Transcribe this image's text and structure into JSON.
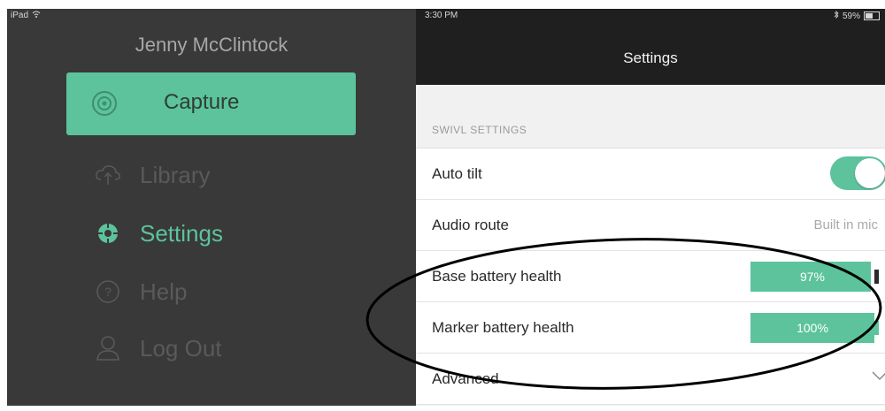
{
  "status_bar": {
    "device": "iPad",
    "time": "3:30 PM",
    "battery": "59%"
  },
  "sidebar": {
    "user_name": "Jenny McClintock",
    "capture_label": "Capture",
    "items": [
      {
        "label": "Library",
        "icon": "cloud-upload-icon"
      },
      {
        "label": "Settings",
        "icon": "gear-icon",
        "active": true
      },
      {
        "label": "Help",
        "icon": "help-icon"
      },
      {
        "label": "Log Out",
        "icon": "user-icon"
      }
    ]
  },
  "settings": {
    "title": "Settings",
    "section_header": "SWIVL SETTINGS",
    "auto_tilt": {
      "label": "Auto tilt",
      "on": true
    },
    "audio_route": {
      "label": "Audio route",
      "value": "Built in mic"
    },
    "base_battery": {
      "label": "Base battery health",
      "value": "97%",
      "fraction": 0.97
    },
    "marker_battery": {
      "label": "Marker battery health",
      "value": "100%",
      "fraction": 1.0
    },
    "advanced": {
      "label": "Advanced"
    }
  },
  "colors": {
    "accent": "#5cc39d",
    "sidebar_bg": "#393939",
    "topbar_bg": "#1f1f1f",
    "annotation": "#000000"
  }
}
